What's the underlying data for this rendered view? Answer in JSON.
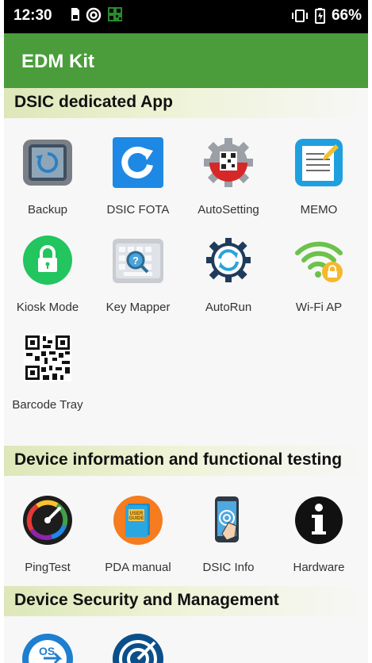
{
  "status_bar": {
    "time": "12:30",
    "battery": "66%"
  },
  "app_title": "EDM Kit",
  "sections": [
    {
      "title": "DSIC dedicated App"
    },
    {
      "title": "Device information and functional testing"
    },
    {
      "title": "Device Security and Management"
    }
  ],
  "apps_dedicated": [
    {
      "label": "Backup",
      "icon": "backup-icon"
    },
    {
      "label": "DSIC FOTA",
      "icon": "refresh-icon"
    },
    {
      "label": "AutoSetting",
      "icon": "gear-qr-icon"
    },
    {
      "label": "MEMO",
      "icon": "notepad-icon"
    },
    {
      "label": "Kiosk Mode",
      "icon": "lock-icon"
    },
    {
      "label": "Key Mapper",
      "icon": "keyboard-icon"
    },
    {
      "label": "AutoRun",
      "icon": "gear-sync-icon"
    },
    {
      "label": "Wi-Fi AP",
      "icon": "wifi-lock-icon"
    },
    {
      "label": "Barcode Tray",
      "icon": "qr-code-icon"
    }
  ],
  "apps_testing": [
    {
      "label": "PingTest",
      "icon": "speedometer-icon"
    },
    {
      "label": "PDA manual",
      "icon": "user-guide-icon"
    },
    {
      "label": "DSIC Info",
      "icon": "phone-touch-icon"
    },
    {
      "label": "Hardware",
      "icon": "info-icon"
    }
  ],
  "apps_security": [
    {
      "label": "",
      "icon": "os-update-icon"
    },
    {
      "label": "",
      "icon": "radar-icon"
    }
  ],
  "colors": {
    "appbar": "#4a9d3a",
    "status_bar": "#000000",
    "section_band": "#dde7b8"
  }
}
